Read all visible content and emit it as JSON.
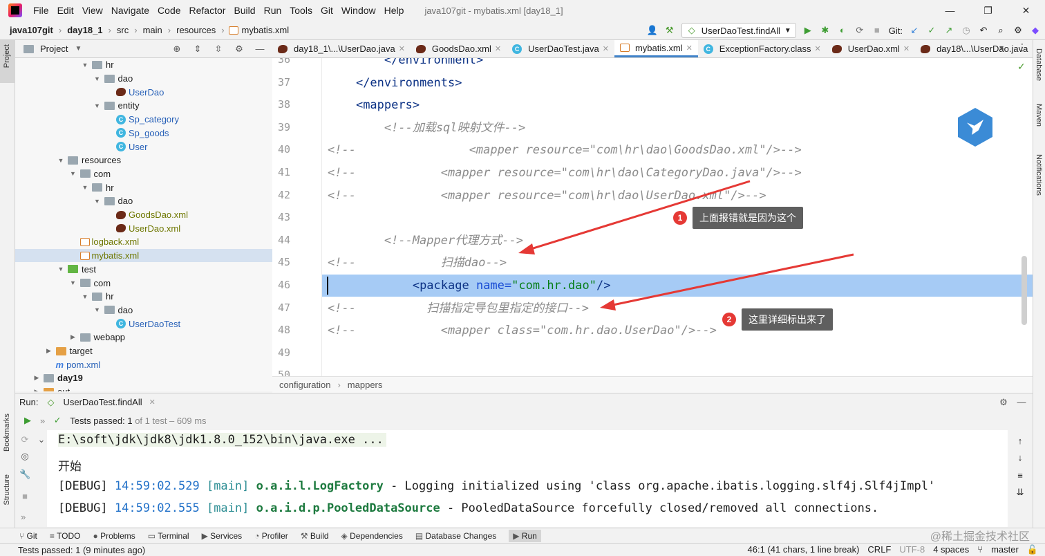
{
  "menubar": {
    "items": [
      "File",
      "Edit",
      "View",
      "Navigate",
      "Code",
      "Refactor",
      "Build",
      "Run",
      "Tools",
      "Git",
      "Window",
      "Help"
    ],
    "window_title": "java107git - mybatis.xml [day18_1]",
    "min": "—",
    "max": "❐",
    "close": "✕"
  },
  "navbar": {
    "crumbs": [
      "java107git",
      "day18_1",
      "src",
      "main",
      "resources",
      "mybatis.xml"
    ],
    "run_config": "UserDaoTest.findAll",
    "git_label": "Git:"
  },
  "project": {
    "title": "Project",
    "tree": [
      {
        "label": "hr",
        "kind": "folder",
        "depth": 6,
        "expanded": true
      },
      {
        "label": "dao",
        "kind": "folder",
        "depth": 7,
        "expanded": true
      },
      {
        "label": "UserDao",
        "kind": "mapper-iface",
        "depth": 8
      },
      {
        "label": "entity",
        "kind": "folder",
        "depth": 7,
        "expanded": true
      },
      {
        "label": "Sp_category",
        "kind": "class",
        "depth": 8
      },
      {
        "label": "Sp_goods",
        "kind": "class",
        "depth": 8
      },
      {
        "label": "User",
        "kind": "class",
        "depth": 8
      },
      {
        "label": "resources",
        "kind": "res-folder",
        "depth": 4,
        "expanded": true
      },
      {
        "label": "com",
        "kind": "folder",
        "depth": 5,
        "expanded": true
      },
      {
        "label": "hr",
        "kind": "folder",
        "depth": 6,
        "expanded": true
      },
      {
        "label": "dao",
        "kind": "folder",
        "depth": 7,
        "expanded": true
      },
      {
        "label": "GoodsDao.xml",
        "kind": "mapper-xml",
        "depth": 8
      },
      {
        "label": "UserDao.xml",
        "kind": "mapper-xml",
        "depth": 8
      },
      {
        "label": "logback.xml",
        "kind": "xml",
        "depth": 5
      },
      {
        "label": "mybatis.xml",
        "kind": "xml",
        "depth": 5,
        "selected": true
      },
      {
        "label": "test",
        "kind": "test-folder",
        "depth": 4,
        "expanded": true
      },
      {
        "label": "com",
        "kind": "folder",
        "depth": 5,
        "expanded": true
      },
      {
        "label": "hr",
        "kind": "folder",
        "depth": 6,
        "expanded": true
      },
      {
        "label": "dao",
        "kind": "folder",
        "depth": 7,
        "expanded": true
      },
      {
        "label": "UserDaoTest",
        "kind": "class",
        "depth": 8
      },
      {
        "label": "webapp",
        "kind": "folder",
        "depth": 5,
        "expanded": false
      },
      {
        "label": "target",
        "kind": "orange-folder",
        "depth": 3,
        "expanded": false
      },
      {
        "label": "pom.xml",
        "kind": "maven",
        "depth": 3
      },
      {
        "label": "day19",
        "kind": "module",
        "depth": 2,
        "expanded": false
      },
      {
        "label": "out",
        "kind": "orange-folder",
        "depth": 2,
        "expanded": false
      }
    ]
  },
  "tabs": [
    {
      "label": "day18_1\\...\\UserDao.java",
      "active": false
    },
    {
      "label": "GoodsDao.xml",
      "active": false
    },
    {
      "label": "UserDaoTest.java",
      "active": false
    },
    {
      "label": "mybatis.xml",
      "active": true
    },
    {
      "label": "ExceptionFactory.class",
      "active": false
    },
    {
      "label": "UserDao.xml",
      "active": false
    },
    {
      "label": "day18\\...\\UserDao.java",
      "active": false
    }
  ],
  "editor": {
    "lines": [
      {
        "n": "36",
        "parts": [
          [
            "plain",
            "        "
          ],
          [
            "tag",
            "</environment>"
          ]
        ]
      },
      {
        "n": "37",
        "parts": [
          [
            "plain",
            "    "
          ],
          [
            "tag",
            "</environments>"
          ]
        ]
      },
      {
        "n": "38",
        "parts": [
          [
            "plain",
            "    "
          ],
          [
            "tag",
            "<mappers>"
          ]
        ]
      },
      {
        "n": "39",
        "parts": [
          [
            "cmt",
            "        <!--加载sql映射文件-->"
          ]
        ]
      },
      {
        "n": "40",
        "parts": [
          [
            "cmt",
            "<!--                <mapper resource=\"com\\hr\\dao\\GoodsDao.xml\"/>-->"
          ]
        ]
      },
      {
        "n": "41",
        "parts": [
          [
            "cmt",
            "<!--            <mapper resource=\"com\\hr\\dao\\CategoryDao.java\"/>-->"
          ]
        ]
      },
      {
        "n": "42",
        "parts": [
          [
            "cmt",
            "<!--            <mapper resource=\"com\\hr\\dao\\UserDao.xml\"/>-->"
          ]
        ]
      },
      {
        "n": "43",
        "parts": [
          [
            "plain",
            ""
          ]
        ]
      },
      {
        "n": "44",
        "parts": [
          [
            "cmt",
            "        <!--Mapper代理方式-->"
          ]
        ]
      },
      {
        "n": "45",
        "parts": [
          [
            "cmt",
            "<!--            扫描dao-->"
          ]
        ]
      },
      {
        "n": "46",
        "parts": [
          [
            "plain",
            "            "
          ],
          [
            "tag",
            "<package "
          ],
          [
            "attr",
            "name="
          ],
          [
            "val",
            "\"com.hr.dao\""
          ],
          [
            "tag",
            "/>"
          ]
        ]
      },
      {
        "n": "47",
        "parts": [
          [
            "cmt",
            "<!--          扫描指定导包里指定的接口-->"
          ]
        ]
      },
      {
        "n": "48",
        "parts": [
          [
            "cmt",
            "<!--            <mapper class=\"com.hr.dao.UserDao\"/>-->"
          ]
        ]
      },
      {
        "n": "49",
        "parts": [
          [
            "plain",
            ""
          ]
        ]
      },
      {
        "n": "50",
        "parts": [
          [
            "plain",
            ""
          ]
        ]
      }
    ],
    "breadcrumb": [
      "configuration",
      "mappers"
    ]
  },
  "callouts": [
    {
      "num": "1",
      "text": "上面报错就是因为这个"
    },
    {
      "num": "2",
      "text": "这里详细标出来了"
    }
  ],
  "run": {
    "label": "Run:",
    "tab": "UserDaoTest.findAll",
    "status_prefix": "Tests passed: ",
    "status_count": "1",
    "status_rest": " of 1 test – 609 ms",
    "console": {
      "line1": "E:\\soft\\jdk\\jdk8\\jdk1.8.0_152\\bin\\java.exe ...",
      "line2": "开始",
      "line3": {
        "lvl": "[DEBUG] ",
        "time": "14:59:02.529 ",
        "thread": "[main] ",
        "logger": "o.a.i.l.LogFactory",
        "msg": " - Logging initialized using 'class org.apache.ibatis.logging.slf4j.Slf4jImpl'"
      },
      "line4": {
        "lvl": "[DEBUG] ",
        "time": "14:59:02.555 ",
        "thread": "[main] ",
        "logger": "o.a.i.d.p.PooledDataSource",
        "msg": " - PooledDataSource forcefully closed/removed all connections."
      }
    }
  },
  "toolwindows": [
    "Git",
    "TODO",
    "Problems",
    "Terminal",
    "Services",
    "Profiler",
    "Build",
    "Dependencies",
    "Database Changes",
    "Run"
  ],
  "statusbar": {
    "left": "Tests passed: 1 (9 minutes ago)",
    "pos": "46:1 (41 chars, 1 line break)",
    "eol": "CRLF",
    "enc": "UTF-8",
    "indent": "4 spaces",
    "branch": "master"
  },
  "side_labels": {
    "project": "Project",
    "bookmarks": "Bookmarks",
    "structure": "Structure",
    "database": "Database",
    "maven": "Maven",
    "notifications": "Notifications"
  },
  "watermark": "@稀土掘金技术社区"
}
